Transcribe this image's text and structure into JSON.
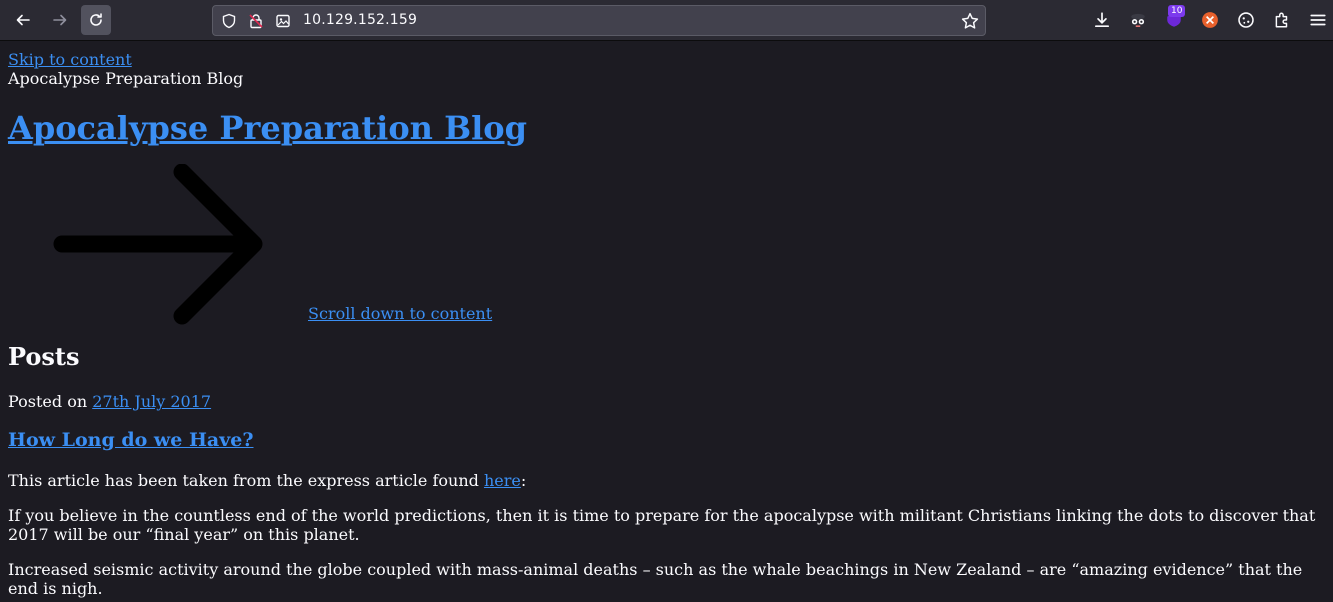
{
  "browser": {
    "url": "10.129.152.159",
    "extension_badge": "10",
    "icons": {
      "back": "back-arrow-icon",
      "forward": "forward-arrow-icon",
      "reload": "reload-icon",
      "shield": "shield-icon",
      "lock": "insecure-lock-icon",
      "page": "image-icon",
      "bookmark": "star-icon",
      "downloads": "download-icon",
      "menu": "hamburger-menu-icon"
    }
  },
  "page": {
    "skip_link": "Skip to content",
    "site_description": "Apocalypse Preparation Blog",
    "site_title": "Apocalypse Preparation Blog",
    "scroll_link": "Scroll down to content",
    "posts_heading": "Posts",
    "posted_on_label": "Posted on",
    "post_date": "27th July 2017",
    "post_title": "How Long do we Have?",
    "intro_text": "This article has been taken from the express article found ",
    "intro_link": "here",
    "intro_suffix": ":",
    "paragraph_1": "If you believe in the countless end of the world predictions, then it is time to prepare for the apocalypse with militant Christians linking the dots to discover that 2017 will be our “final year” on this planet.",
    "paragraph_2": "Increased seismic activity around the globe coupled with mass-animal deaths – such as the whale beachings in New Zealand – are “amazing evidence” that the end is nigh."
  },
  "colors": {
    "background": "#1c1b22",
    "toolbar": "#2b2a33",
    "link": "#3b8ff3",
    "text": "#fbfbfe"
  }
}
